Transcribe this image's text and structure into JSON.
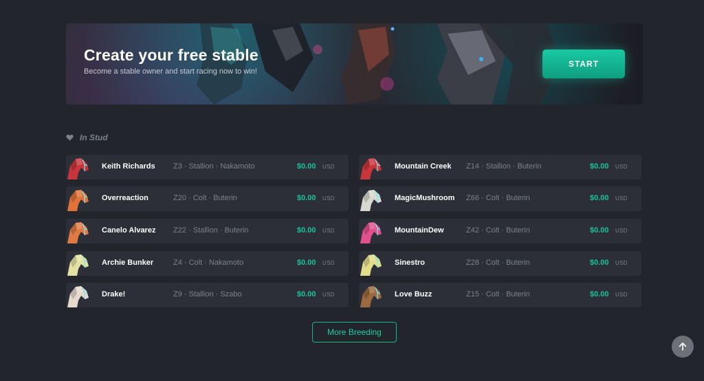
{
  "banner": {
    "title": "Create your free stable",
    "subtitle": "Become a stable owner and start racing now to win!",
    "start_label": "START"
  },
  "section": {
    "icon": "heart-icon",
    "title": "In Stud"
  },
  "horses": [
    {
      "name": "Keith Richards",
      "details": "Z3 · Stallion · Nakamoto",
      "price": "$0.00",
      "currency": "USD",
      "color": "#c8353a"
    },
    {
      "name": "Mountain Creek",
      "details": "Z14 · Stallion · Buterin",
      "price": "$0.00",
      "currency": "USD",
      "color": "#c8353a"
    },
    {
      "name": "Overreaction",
      "details": "Z20 · Colt · Buterin",
      "price": "$0.00",
      "currency": "USD",
      "color": "#e0733a"
    },
    {
      "name": "MagicMushroom",
      "details": "Z66 · Colt · Buterin",
      "price": "$0.00",
      "currency": "USD",
      "color": "#d8d8d0"
    },
    {
      "name": "Canelo Alvarez",
      "details": "Z22 · Stallion · Buterin",
      "price": "$0.00",
      "currency": "USD",
      "color": "#e07a45"
    },
    {
      "name": "MountainDew",
      "details": "Z42 · Colt · Buterin",
      "price": "$0.00",
      "currency": "USD",
      "color": "#e0508c"
    },
    {
      "name": "Archie Bunker",
      "details": "Z4 · Colt · Nakamoto",
      "price": "$0.00",
      "currency": "USD",
      "color": "#e4e2a2"
    },
    {
      "name": "Sinestro",
      "details": "Z28 · Colt · Buterin",
      "price": "$0.00",
      "currency": "USD",
      "color": "#e3dc8a"
    },
    {
      "name": "Drake!",
      "details": "Z9 · Stallion · Szabo",
      "price": "$0.00",
      "currency": "USD",
      "color": "#e6d9cc"
    },
    {
      "name": "Love Buzz",
      "details": "Z15 · Colt · Buterin",
      "price": "$0.00",
      "currency": "USD",
      "color": "#9b6a3f"
    }
  ],
  "more_button_label": "More Breeding",
  "scroll_top_icon": "arrow-up-icon",
  "colors": {
    "accent": "#18c29b",
    "background": "#22252c",
    "row_background": "#2c2f37"
  }
}
